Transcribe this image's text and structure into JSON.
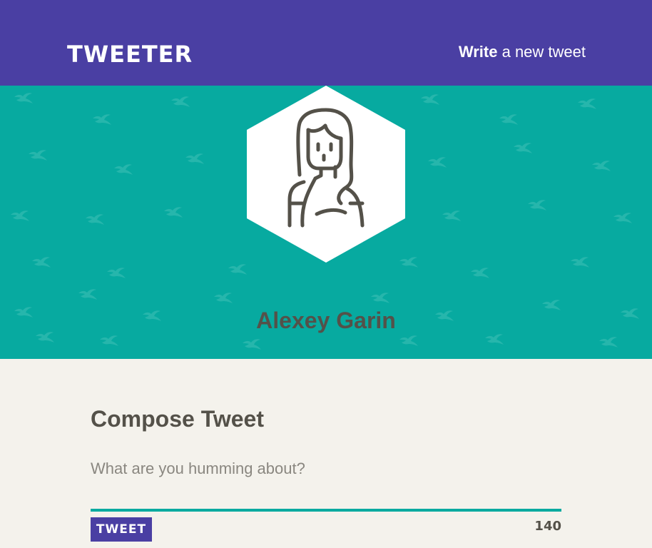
{
  "nav": {
    "logo": "TWEETER",
    "write_bold": "Write",
    "write_rest": " a new tweet"
  },
  "profile": {
    "name": "Alexey Garin",
    "avatar_icon": "user-avatar-icon"
  },
  "compose": {
    "title": "Compose Tweet",
    "placeholder": "What are you humming about?",
    "value": "",
    "button_label": "TWEET",
    "counter": "140"
  },
  "colors": {
    "nav_bg": "#4a3fa3",
    "banner_bg": "#07aaa0",
    "page_bg": "#f4f2ec",
    "text": "#545149",
    "accent": "#07aaa0"
  }
}
